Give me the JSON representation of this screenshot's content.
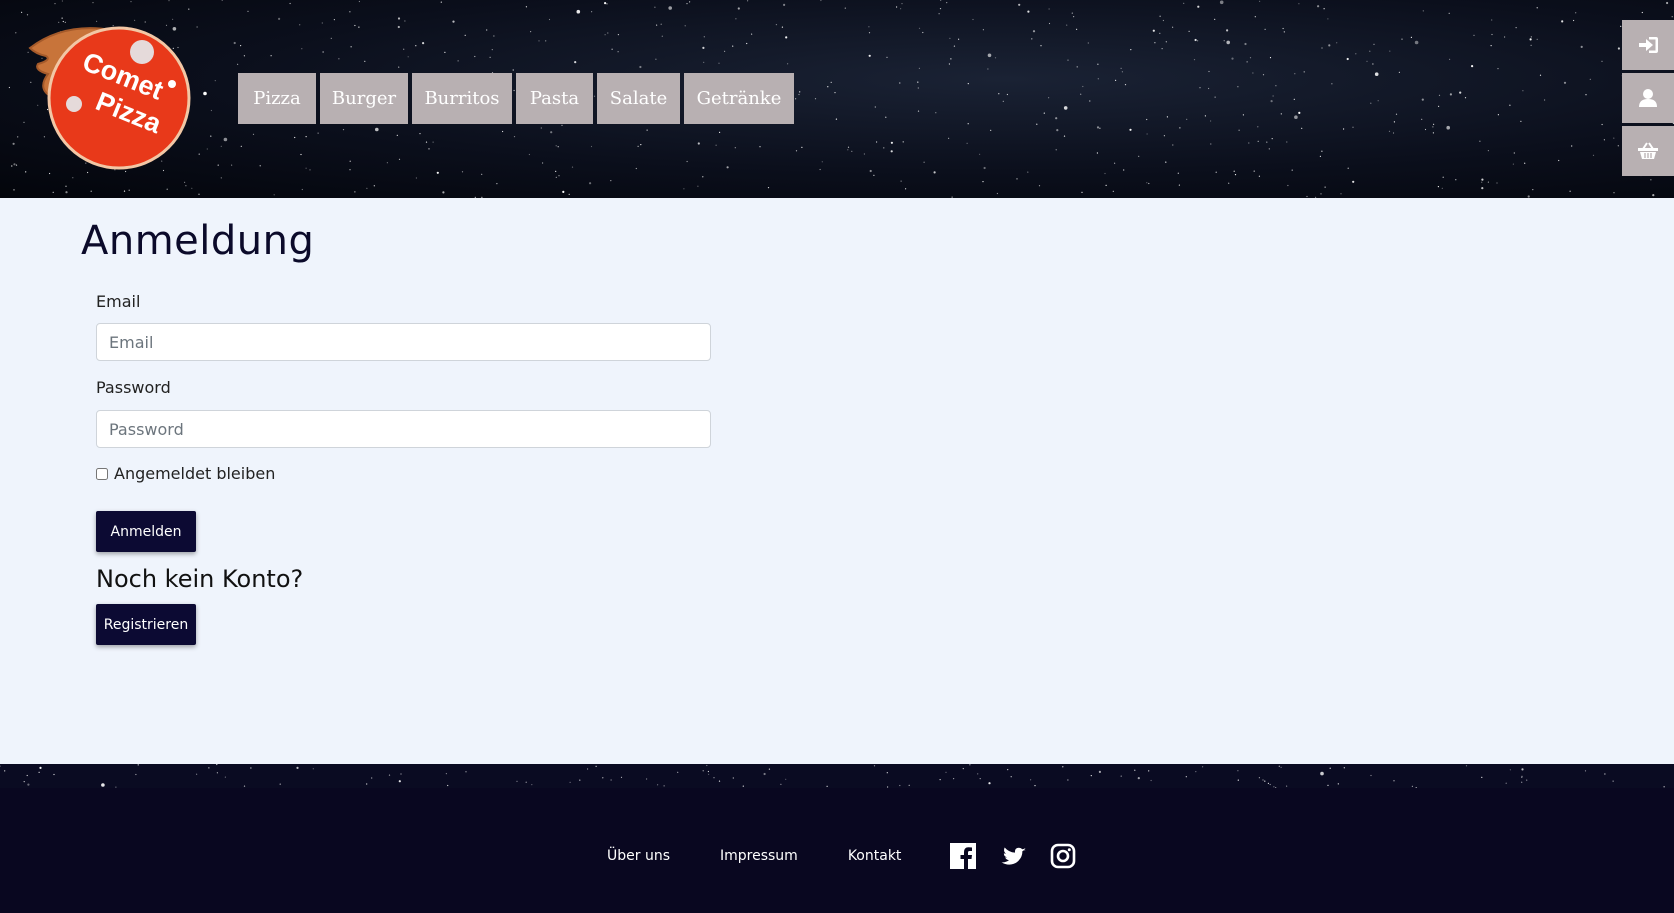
{
  "logo": {
    "line1": "Comet",
    "line2": "Pizza",
    "color": "#e8391a"
  },
  "nav": {
    "items": [
      {
        "label": "Pizza"
      },
      {
        "label": "Burger"
      },
      {
        "label": "Burritos"
      },
      {
        "label": "Pasta"
      },
      {
        "label": "Salate"
      },
      {
        "label": "Getränke"
      }
    ]
  },
  "side_buttons": [
    {
      "icon": "sign-in-icon"
    },
    {
      "icon": "user-icon"
    },
    {
      "icon": "basket-icon"
    }
  ],
  "main": {
    "title": "Anmeldung",
    "email_label": "Email",
    "email_placeholder": "Email",
    "password_label": "Password",
    "password_placeholder": "Password",
    "remember_label": "Angemeldet bleiben",
    "login_button": "Anmelden",
    "no_account": "Noch kein Konto?",
    "register_button": "Registrieren"
  },
  "footer": {
    "links": [
      "Über uns",
      "Impressum",
      "Kontakt"
    ],
    "social": [
      "facebook-icon",
      "twitter-icon",
      "instagram-icon"
    ]
  },
  "colors": {
    "primary": "#0c0a33",
    "nav_bg": "#b8b0b2",
    "footer_bg": "#090720",
    "page_bg": "#eff4fc"
  }
}
